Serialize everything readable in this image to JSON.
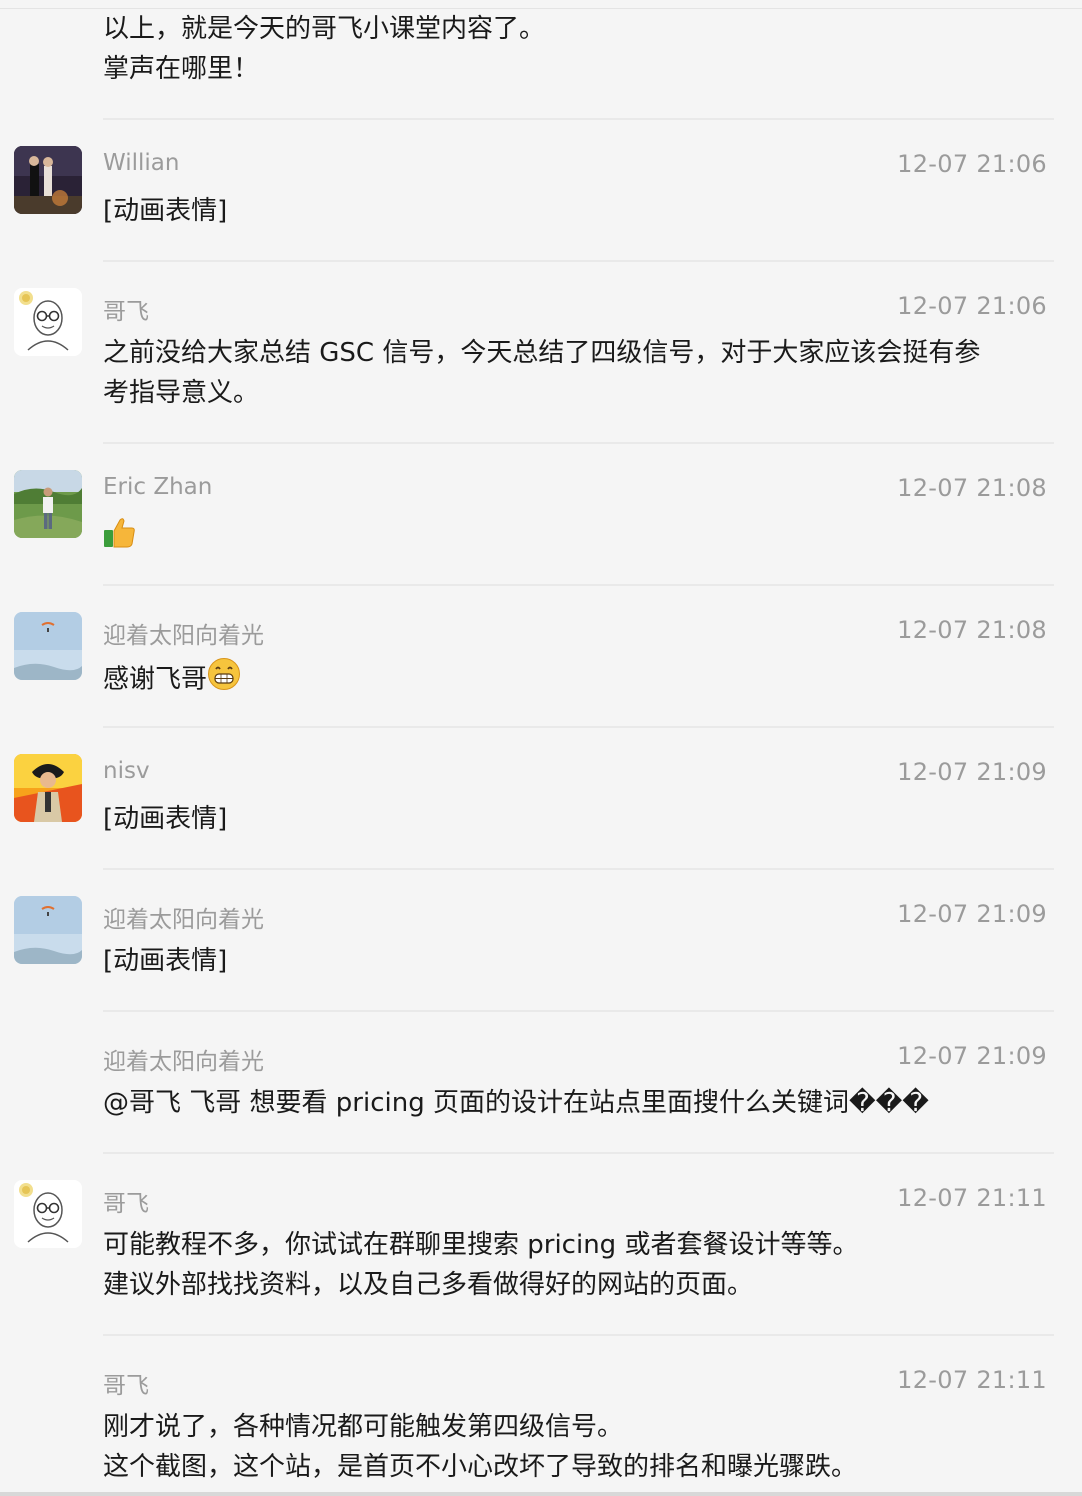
{
  "messages": [
    {
      "sender": "",
      "time": "",
      "lines": [
        "以上，就是今天的哥飞小课堂内容了。",
        "掌声在哪里！"
      ]
    },
    {
      "sender": "Willian",
      "time": "12-07 21:06",
      "avatar": "photo-couple-avatar",
      "lines": [
        "[动画表情]"
      ]
    },
    {
      "sender": "哥飞",
      "time": "12-07 21:06",
      "avatar": "cartoon-glasses-avatar",
      "lines": [
        "之前没给大家总结 GSC 信号，今天总结了四级信号，对于大家应该会挺有参",
        "考指导意义。"
      ]
    },
    {
      "sender": "Eric Zhan",
      "time": "12-07 21:08",
      "avatar": "photo-hiker-avatar",
      "lines": [
        ""
      ],
      "emoji": "thumbs-up-emoji"
    },
    {
      "sender": "迎着太阳向着光",
      "time": "12-07 21:08",
      "avatar": "sky-paraglider-avatar",
      "lines": [
        "感谢飞哥"
      ],
      "emoji": "grin-emoji"
    },
    {
      "sender": "nisv",
      "time": "12-07 21:09",
      "avatar": "anime-character-avatar",
      "lines": [
        "[动画表情]"
      ]
    },
    {
      "sender": "迎着太阳向着光",
      "time": "12-07 21:09",
      "avatar": "sky-paraglider-avatar",
      "lines": [
        "[动画表情]"
      ]
    },
    {
      "sender": "迎着太阳向着光",
      "time": "12-07 21:09",
      "lines": [
        "@哥飞 飞哥 想要看 pricing 页面的设计在站点里面搜什么关键词���"
      ]
    },
    {
      "sender": "哥飞",
      "time": "12-07 21:11",
      "avatar": "cartoon-glasses-avatar",
      "lines": [
        "可能教程不多，你试试在群聊里搜索 pricing 或者套餐设计等等。",
        "建议外部找找资料，以及自己多看做得好的网站的页面。"
      ]
    },
    {
      "sender": "哥飞",
      "time": "12-07 21:11",
      "lines": [
        "刚才说了，各种情况都可能触发第四级信号。",
        "这个截图，这个站，是首页不小心改坏了导致的排名和曝光骤跌。"
      ]
    }
  ],
  "colors": {
    "background": "#f5f5f5",
    "meta_text": "#9b9b9b",
    "body_text": "#1a1a1a",
    "divider": "#e9e9e9"
  }
}
